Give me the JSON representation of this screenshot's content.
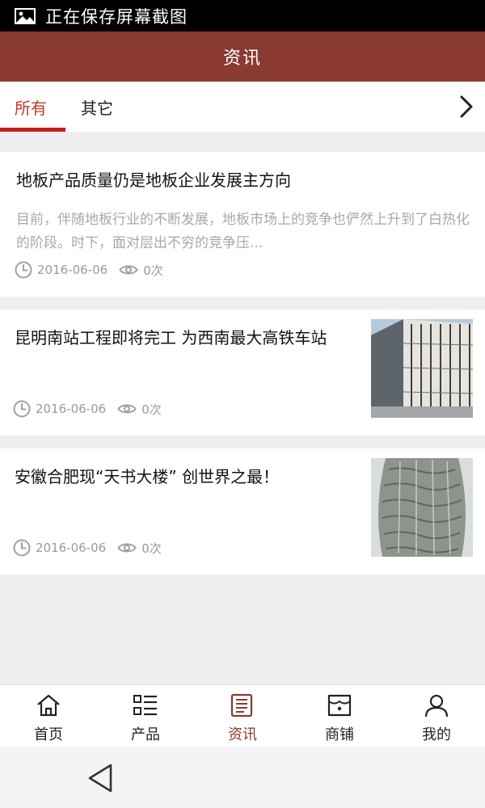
{
  "statusbar": {
    "text": "正在保存屏幕截图",
    "icon": "image-icon"
  },
  "header": {
    "title": "资讯"
  },
  "tabs": [
    {
      "label": "所有",
      "active": true
    },
    {
      "label": "其它",
      "active": false
    }
  ],
  "accent_color": "#c0201a",
  "brand_color": "#8a3a30",
  "articles": [
    {
      "title": "地板产品质量仍是地板企业发展主方向",
      "summary": "目前，伴随地板行业的不断发展，地板市场上的竞争也俨然上升到了白热化的阶段。时下，面对层出不穷的竞争压...",
      "date": "2016-06-06",
      "views": "0次"
    },
    {
      "title": "昆明南站工程即将完工 为西南最大高铁车站",
      "date": "2016-06-06",
      "views": "0次",
      "thumbnail": "building-photo"
    },
    {
      "title": "安徽合肥现“天书大楼” 创世界之最！",
      "date": "2016-06-06",
      "views": "0次",
      "thumbnail": "tower-photo"
    }
  ],
  "bottom_nav": [
    {
      "label": "首页",
      "icon": "home-icon",
      "active": false
    },
    {
      "label": "产品",
      "icon": "list-icon",
      "active": false
    },
    {
      "label": "资讯",
      "icon": "news-icon",
      "active": true
    },
    {
      "label": "商铺",
      "icon": "shop-icon",
      "active": false
    },
    {
      "label": "我的",
      "icon": "user-icon",
      "active": false
    }
  ]
}
